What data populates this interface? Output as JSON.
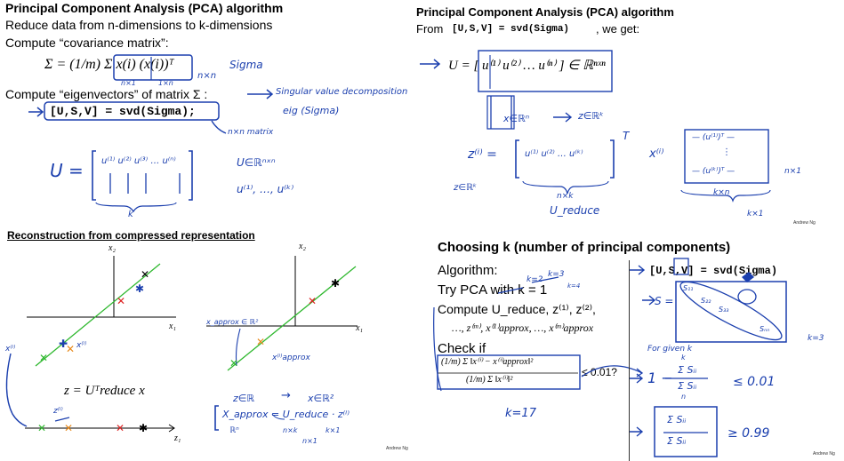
{
  "panel_tl": {
    "title": "Principal Component Analysis (PCA) algorithm",
    "line1": "Reduce data from n-dimensions to k-dimensions",
    "line2": "Compute “covariance matrix”:",
    "sigma_formula": "Σ = (1/m) Σ x(i) (x(i))ᵀ",
    "line3": "Compute “eigenvectors” of matrix Σ :",
    "code": "[U,S,V] = svd(Sigma);",
    "ink_sigma": "Sigma",
    "ink_nxn": "n×n",
    "ink_svd_note": "Singular value decomposition",
    "ink_eig": "eig (Sigma)",
    "ink_nxn_matrix": "n×n matrix",
    "ink_U": "U =",
    "ink_cols": "u⁽¹⁾ u⁽²⁾ u⁽³⁾ … u⁽ⁿ⁾",
    "ink_k": "k",
    "ink_U_in": "U∈ℝⁿˣⁿ",
    "ink_u_list": "u⁽¹⁾, …, u⁽ᵏ⁾",
    "ink_nx1": "n×1",
    "ink_1xn": "1×n"
  },
  "panel_tr": {
    "title": "Principal Component Analysis (PCA) algorithm",
    "from_label": "From",
    "code": "[U,S,V] = svd(Sigma)",
    "we_get": ", we get:",
    "U_formula": "U = [ u⁽¹⁾ u⁽²⁾ … u⁽ⁿ⁾ ] ∈ ℝⁿˣⁿ",
    "ink_x_in": "x∈ℝⁿ",
    "ink_z_in": "z∈ℝᵏ",
    "ink_z_eq": "z⁽ⁱ⁾ =",
    "ink_cols": "u⁽¹⁾ u⁽²⁾ … u⁽ᵏ⁾",
    "ink_T": "T",
    "ink_x_i": "x⁽ⁱ⁾",
    "ink_rows": [
      "— (u⁽¹⁾)ᵀ —",
      "⋮",
      "— (u⁽ᵏ⁾)ᵀ —"
    ],
    "ink_nxk": "n×k",
    "ink_kxn": "k×n",
    "ink_kx1": "k×1",
    "ink_nx1": "n×1",
    "ink_ureduce": "U_reduce",
    "ink_z_in2": "z∈ℝᵏ",
    "credit": "Andrew Ng"
  },
  "panel_bl": {
    "title": "Reconstruction from compressed representation",
    "x1": "x₁",
    "x2": "x₂",
    "z_formula": "z = Uᵀreduce x",
    "z1": "z₁",
    "ink_xi": "x⁽ⁱ⁾",
    "ink_x_i": "x⁽ⁱ⁾",
    "ink_z_i": "z⁽ⁱ⁾",
    "ink_xapprox_in": "x_approx ∈ ℝ²",
    "ink_xapprox": "x⁽ⁱ⁾approx",
    "ink_zR": "z∈ℝ",
    "ink_arrow": "→",
    "ink_xR2": "x∈ℝ²",
    "ink_eq": "X_approx = U_reduce · z⁽ⁱ⁾",
    "ink_Rn": "ℝⁿ",
    "ink_nxk": "n×k",
    "ink_kx1": "k×1",
    "ink_nx1": "n×1",
    "credit": "Andrew Ng"
  },
  "panel_br": {
    "title": "Choosing k (number of principal components)",
    "algorithm": "Algorithm:",
    "try_pca": "Try PCA with k = 1",
    "compute": "Compute U_reduce, z⁽¹⁾, z⁽²⁾,",
    "compute2": "…, z⁽ᵐ⁾, x⁽¹⁾approx, …, x⁽ᵐ⁾approx",
    "check": "Check if",
    "ratio_num": "(1/m) Σ ‖x⁽ⁱ⁾ − x⁽ⁱ⁾approx‖²",
    "ratio_den": "(1/m) Σ ‖x⁽ⁱ⁾‖²",
    "leq": "≤ 0.01?",
    "code": "[U,S,V] = svd(Sigma)",
    "ink_k2": "k=2",
    "ink_k3": "k=3",
    "ink_k4": "k=4",
    "ink_k17": "k=17",
    "ink_S": "S =",
    "ink_s11": "S₁₁",
    "ink_s22": "S₂₂",
    "ink_s33": "S₃₃",
    "ink_snn": "Sₙₙ",
    "ink_kk": "k=3",
    "ink_for_given": "For given k",
    "ink_one_minus": "1 −",
    "ink_sum_ratio_num": "Σ Sᵢᵢ",
    "ink_sum_ratio_den": "Σ Sᵢᵢ",
    "ink_k_top": "k",
    "ink_n_bot": "n",
    "ink_leq": "≤ 0.01",
    "ink_geq": "≥ 0.99",
    "credit": "Andrew Ng"
  },
  "colors": {
    "ink": "#1b3fae",
    "green_line": "#2eb82e",
    "red": "#d22",
    "orange": "#e8891a"
  }
}
